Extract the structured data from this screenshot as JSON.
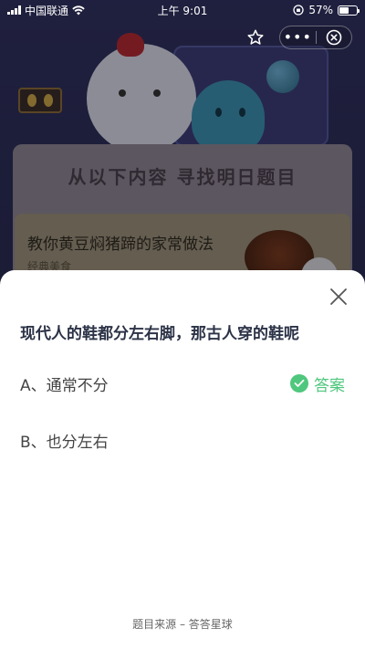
{
  "status_bar": {
    "carrier": "中国联通",
    "time": "上午 9:01",
    "battery": "57%",
    "battery_level": 0.57
  },
  "capsule": {
    "more_label": "•••"
  },
  "background": {
    "search_title": "从以下内容  寻找明日题目",
    "result_title": "教你黄豆焖猪蹄的家常做法",
    "result_subtitle": "经典美食"
  },
  "quiz": {
    "question": "现代人的鞋都分左右脚，那古人穿的鞋呢",
    "options": [
      {
        "label": "A、通常不分",
        "is_answer": true
      },
      {
        "label": "B、也分左右",
        "is_answer": false
      }
    ],
    "answer_label": "答案",
    "source": "题目来源 – 答答星球"
  },
  "colors": {
    "accent_green": "#4fc77d",
    "question_text": "#2c3347"
  },
  "icons": {
    "star": "star-icon",
    "close": "close-icon",
    "check": "check-icon",
    "wifi": "wifi-icon"
  }
}
